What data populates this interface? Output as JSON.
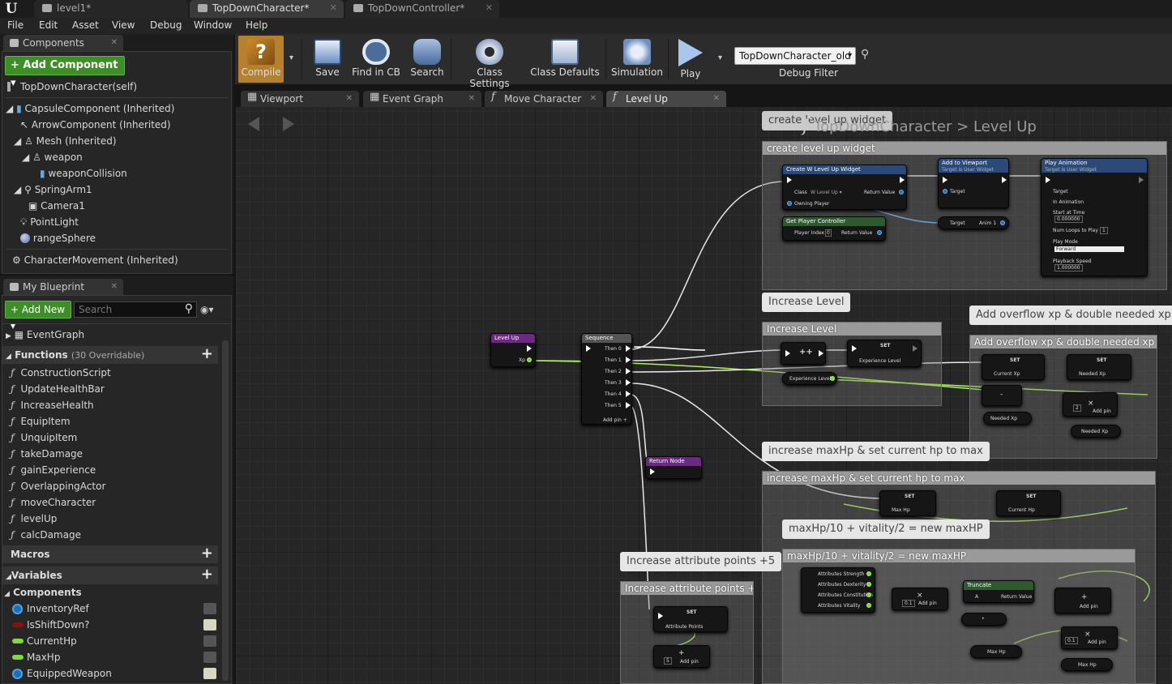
{
  "document_tabs": [
    {
      "label": "level1*",
      "active": false
    },
    {
      "label": "TopDownCharacter*",
      "active": true
    },
    {
      "label": "TopDownController*",
      "active": false
    }
  ],
  "logo": "U",
  "menu": [
    "File",
    "Edit",
    "Asset",
    "View",
    "Debug",
    "Window",
    "Help"
  ],
  "components_panel": {
    "tab_label": "Components",
    "add_button": "+ Add Component ▾",
    "self_label": "TopDownCharacter(self)",
    "tree": [
      {
        "label": "CapsuleComponent (Inherited)"
      },
      {
        "label": "ArrowComponent (Inherited)"
      },
      {
        "label": "Mesh (Inherited)"
      },
      {
        "label": "weapon"
      },
      {
        "label": "weaponCollision"
      },
      {
        "label": "SpringArm1"
      },
      {
        "label": "Camera1"
      },
      {
        "label": "PointLight"
      },
      {
        "label": "rangeSphere"
      },
      {
        "label": "CharacterMovement (Inherited)"
      }
    ]
  },
  "my_blueprint": {
    "tab_label": "My Blueprint",
    "add_new": "+ Add New ▾",
    "search_placeholder": "Search",
    "event_graph": "EventGraph",
    "functions_label": "Functions",
    "functions_count": "(30 Overridable)",
    "functions": [
      "ConstructionScript",
      "UpdateHealthBar",
      "IncreaseHealth",
      "EquipItem",
      "UnquipItem",
      "takeDamage",
      "gainExperience",
      "OverlappingActor",
      "moveCharacter",
      "levelUp",
      "calcDamage"
    ],
    "macros_label": "Macros",
    "variables_label": "Variables",
    "components_label": "Components",
    "variables": [
      {
        "name": "InventoryRef",
        "color": "#1a6fb5",
        "kind": "object",
        "public": false
      },
      {
        "name": "IsShiftDown?",
        "color": "#8b0f0f",
        "kind": "bool",
        "public": true
      },
      {
        "name": "CurrentHp",
        "color": "#7ddc3a",
        "kind": "float",
        "public": false
      },
      {
        "name": "MaxHp",
        "color": "#7ddc3a",
        "kind": "float",
        "public": false
      },
      {
        "name": "EquippedWeapon",
        "color": "#1a6fb5",
        "kind": "object",
        "public": true
      }
    ]
  },
  "toolbar": {
    "buttons": [
      {
        "label": "Compile"
      },
      {
        "label": "Save"
      },
      {
        "label": "Find in CB"
      },
      {
        "label": "Search"
      },
      {
        "label": "Class Settings"
      },
      {
        "label": "Class Defaults"
      },
      {
        "label": "Simulation"
      },
      {
        "label": "Play"
      }
    ],
    "debug_object": "TopDownCharacter_old",
    "debug_filter_label": "Debug Filter"
  },
  "graph_tabs": [
    {
      "label": "Viewport",
      "active": false
    },
    {
      "label": "Event Graph",
      "active": false
    },
    {
      "label": "Move Character",
      "active": false
    },
    {
      "label": "Level Up",
      "active": true
    }
  ],
  "breadcrumb": {
    "root": "TopDownCharacter",
    "separator": ">",
    "current": "Level Up"
  },
  "comments": {
    "create_widget_bubble": "create level up widget",
    "create_widget": "create level up widget",
    "increase_level": "Increase Level",
    "overflow": "Add overflow xp & double needed xp",
    "maxhp": "increase maxHp & set current hp to max",
    "maxhp_formula": "maxHp/10 + vitality/2 = new maxHP",
    "attribute_points": "Increase attribute points +5"
  },
  "nodes": {
    "level_up": {
      "title": "Level Up",
      "xp": "Xp"
    },
    "sequence": {
      "title": "Sequence",
      "pins": [
        "Then 0",
        "Then 1",
        "Then 2",
        "Then 3",
        "Then 4",
        "Then 5"
      ],
      "add_pin": "Add pin +"
    },
    "return_node": "Return Node",
    "create_widget": {
      "title": "Create W Level Up Widget",
      "class_label": "Class",
      "class_value": "W Level Up ▾",
      "owning": "Owning Player",
      "return": "Return Value"
    },
    "get_pc": {
      "title": "Get Player Controller",
      "player_index": "Player Index",
      "index_value": "0",
      "return": "Return Value"
    },
    "add_viewport": {
      "title": "Add to Viewport",
      "subtitle": "Target is User Widget",
      "target": "Target"
    },
    "play_anim": {
      "title": "Play Animation",
      "subtitle": "Target is User Widget",
      "target": "Target",
      "in_anim": "In Animation",
      "start": "Start at Time",
      "start_val": "0.000000",
      "loops": "Num Loops to Play",
      "loops_val": "1",
      "mode": "Play Mode",
      "mode_val": "Forward",
      "speed": "Playback Speed",
      "speed_val": "1.000000"
    },
    "anim_getter": {
      "target": "Target",
      "anim": "Anim 1"
    },
    "set": "SET",
    "experience_level": "Experience Level",
    "current_xp": "Current Xp",
    "needed_xp": "Needed Xp",
    "max_hp": "Max Hp",
    "current_hp": "Current Hp",
    "attribute_points": "Attribute Points",
    "add_pin": "Add pin",
    "increment": "++",
    "minus": "-",
    "multiply": "×",
    "two": "2",
    "five": "5",
    "point_one": "0.1",
    "truncate": {
      "title": "Truncate",
      "a": "A",
      "return": "Return Value"
    },
    "attributes": [
      "Attributes Strength",
      "Attributes Dexterity",
      "Attributes Constitution",
      "Attributes Vitality"
    ]
  }
}
